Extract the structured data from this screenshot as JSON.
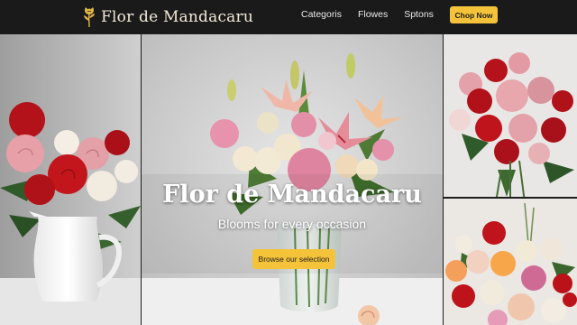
{
  "brand": {
    "name": "Flor de Mandacaru",
    "logo_icon": "rose-icon"
  },
  "nav": {
    "links": [
      {
        "label": "Categoris"
      },
      {
        "label": "Flowes"
      },
      {
        "label": "Sptons"
      }
    ],
    "cta_label": "Chop Now"
  },
  "hero": {
    "title": "Flor de Mandacaru",
    "subtitle": "Blooms for every occasion",
    "cta_label": "Browse our selection"
  },
  "colors": {
    "accent": "#f4c33a",
    "nav_background": "#1a1a1a",
    "brand_text": "#f3ead8"
  }
}
